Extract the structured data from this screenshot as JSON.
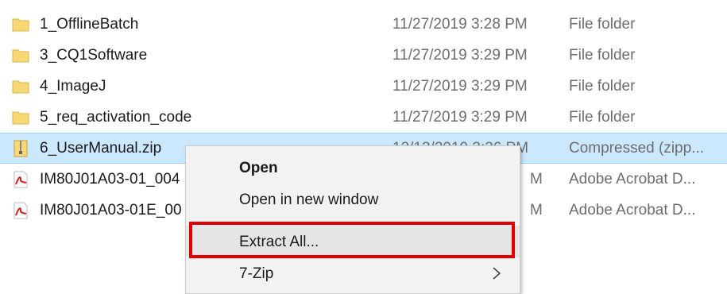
{
  "files": [
    {
      "name": "1_OfflineBatch",
      "date": "11/27/2019 3:28 PM",
      "type": "File folder",
      "icon": "folder-icon"
    },
    {
      "name": "3_CQ1Software",
      "date": "11/27/2019 3:29 PM",
      "type": "File folder",
      "icon": "folder-icon"
    },
    {
      "name": "4_ImageJ",
      "date": "11/27/2019 3:29 PM",
      "type": "File folder",
      "icon": "folder-icon"
    },
    {
      "name": "5_req_activation_code",
      "date": "11/27/2019 3:29 PM",
      "type": "File folder",
      "icon": "folder-icon"
    },
    {
      "name": "6_UserManual.zip",
      "date": "12/13/2019 3:36 PM",
      "type": "Compressed (zipp...",
      "icon": "zip-file-icon",
      "selected": true
    },
    {
      "name": "IM80J01A03-01_004",
      "date": "M",
      "type": "Adobe Acrobat D...",
      "icon": "pdf-file-icon"
    },
    {
      "name": "IM80J01A03-01E_00",
      "date": "M",
      "type": "Adobe Acrobat D...",
      "icon": "pdf-file-icon"
    }
  ],
  "context_menu": {
    "items": [
      {
        "label": "Open",
        "bold": true
      },
      {
        "label": "Open in new window"
      },
      {
        "label": "Extract All...",
        "hover": true
      },
      {
        "label": "7-Zip",
        "submenu": true
      }
    ]
  },
  "colors": {
    "selection": "#cce8ff",
    "highlight": "#e00000",
    "folder": "#f8d775"
  }
}
